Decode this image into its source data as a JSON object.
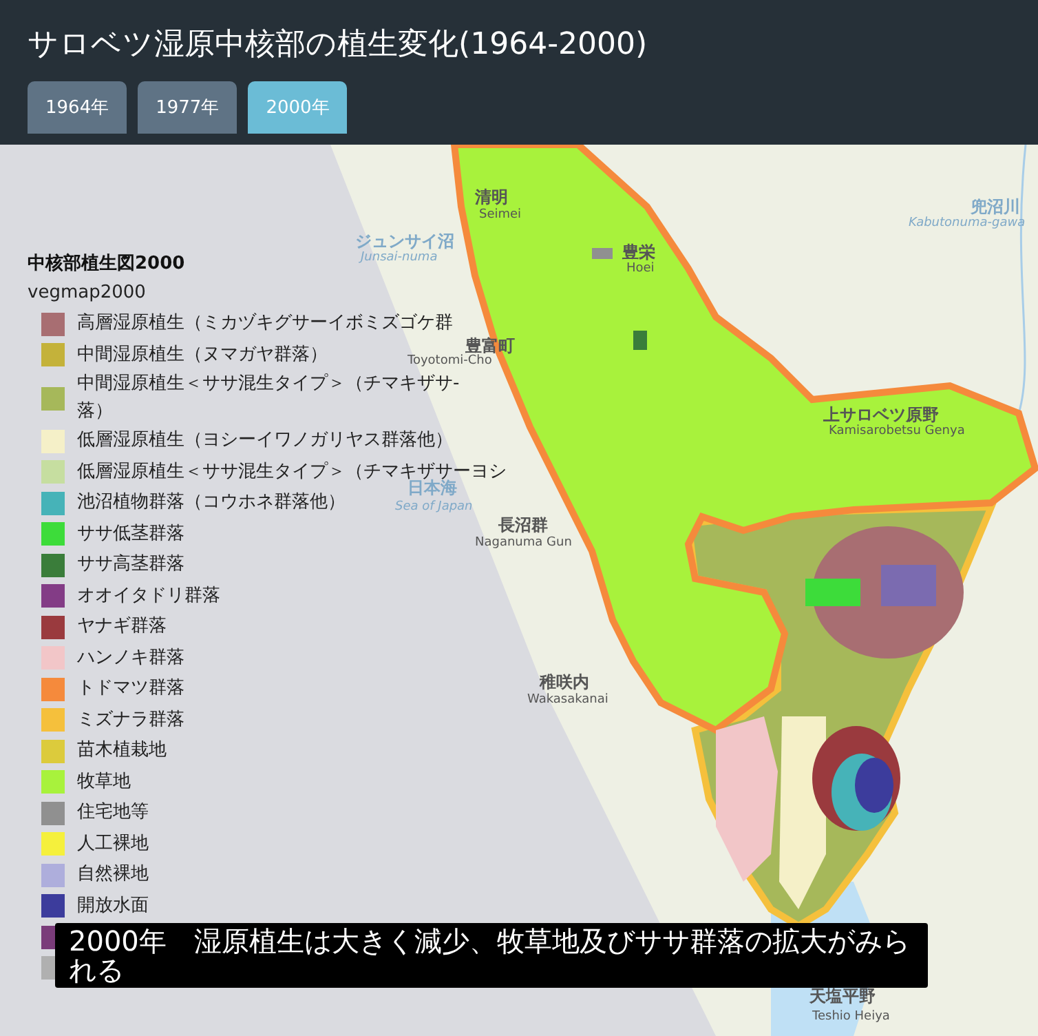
{
  "header": {
    "title": "サロベツ湿原中核部の植生変化(1964-2000)"
  },
  "tabs": [
    {
      "label": "1964年",
      "selected": false
    },
    {
      "label": "1977年",
      "selected": false
    },
    {
      "label": "2000年",
      "selected": true
    }
  ],
  "legend": {
    "title": "中核部植生図2000",
    "layer": "vegmap2000",
    "items": [
      {
        "color": "#a86e72",
        "lines": [
          "高層湿原植生（ミカヅキグサーイボミズゴケ群"
        ]
      },
      {
        "color": "#c4b23a",
        "lines": [
          "中間湿原植生（ヌマガヤ群落）"
        ]
      },
      {
        "color": "#a6b85a",
        "lines": [
          "中間湿原植生＜ササ混生タイプ＞（チマキザサ-",
          "落）"
        ]
      },
      {
        "color": "#f5f0c8",
        "lines": [
          "低層湿原植生（ヨシーイワノガリヤス群落他）"
        ]
      },
      {
        "color": "#c6dea0",
        "lines": [
          "低層湿原植生＜ササ混生タイプ＞（チマキザサーヨシ"
        ]
      },
      {
        "color": "#46b3b8",
        "lines": [
          "池沼植物群落（コウホネ群落他）"
        ]
      },
      {
        "color": "#3ddc3a",
        "lines": [
          "ササ低茎群落"
        ]
      },
      {
        "color": "#3a7d3a",
        "lines": [
          "ササ高茎群落"
        ]
      },
      {
        "color": "#833c86",
        "lines": [
          "オオイタドリ群落"
        ]
      },
      {
        "color": "#9a3a3e",
        "lines": [
          "ヤナギ群落"
        ]
      },
      {
        "color": "#f2c6c8",
        "lines": [
          "ハンノキ群落"
        ]
      },
      {
        "color": "#f58a3c",
        "lines": [
          "トドマツ群落"
        ]
      },
      {
        "color": "#f5c03c",
        "lines": [
          "ミズナラ群落"
        ]
      },
      {
        "color": "#dccb3c",
        "lines": [
          "苗木植栽地"
        ]
      },
      {
        "color": "#a8f23c",
        "lines": [
          "牧草地"
        ]
      },
      {
        "color": "#909090",
        "lines": [
          "住宅地等"
        ]
      },
      {
        "color": "#f5f03c",
        "lines": [
          "人工裸地"
        ]
      },
      {
        "color": "#aeaedc",
        "lines": [
          "自然裸地"
        ]
      },
      {
        "color": "#3c3c9c",
        "lines": [
          "開放水面"
        ]
      },
      {
        "color": "#7a3c7a"
      },
      {
        "color": "#b0b0b0"
      }
    ]
  },
  "map_labels": [
    {
      "text": "清明",
      "kind": "town"
    },
    {
      "text": "Seimei",
      "kind": "town_en"
    },
    {
      "text": "ジュンサイ沼",
      "kind": "water"
    },
    {
      "text": "Junsai-numa",
      "kind": "water_en"
    },
    {
      "text": "豊栄",
      "kind": "town"
    },
    {
      "text": "Hoei",
      "kind": "town_en"
    },
    {
      "text": "豊富町",
      "kind": "town"
    },
    {
      "text": "Toyotomi-Cho",
      "kind": "town_en"
    },
    {
      "text": "日本海",
      "kind": "water"
    },
    {
      "text": "Sea of Japan",
      "kind": "water_en"
    },
    {
      "text": "長沼群",
      "kind": "area"
    },
    {
      "text": "Naganuma Gun",
      "kind": "area_en"
    },
    {
      "text": "上サロベツ原野",
      "kind": "area"
    },
    {
      "text": "Kamisarobetsu Genya",
      "kind": "area_en"
    },
    {
      "text": "兜沼川",
      "kind": "water"
    },
    {
      "text": "Kabutonuma-gawa",
      "kind": "water_en"
    },
    {
      "text": "稚咲内",
      "kind": "town"
    },
    {
      "text": "Wakasakanai",
      "kind": "town_en"
    },
    {
      "text": "天塩平野",
      "kind": "area"
    },
    {
      "text": "Teshio Heiya",
      "kind": "area_en"
    }
  ],
  "caption": "2000年　湿原植生は大きく減少、牧草地及びササ群落の拡大がみられる"
}
